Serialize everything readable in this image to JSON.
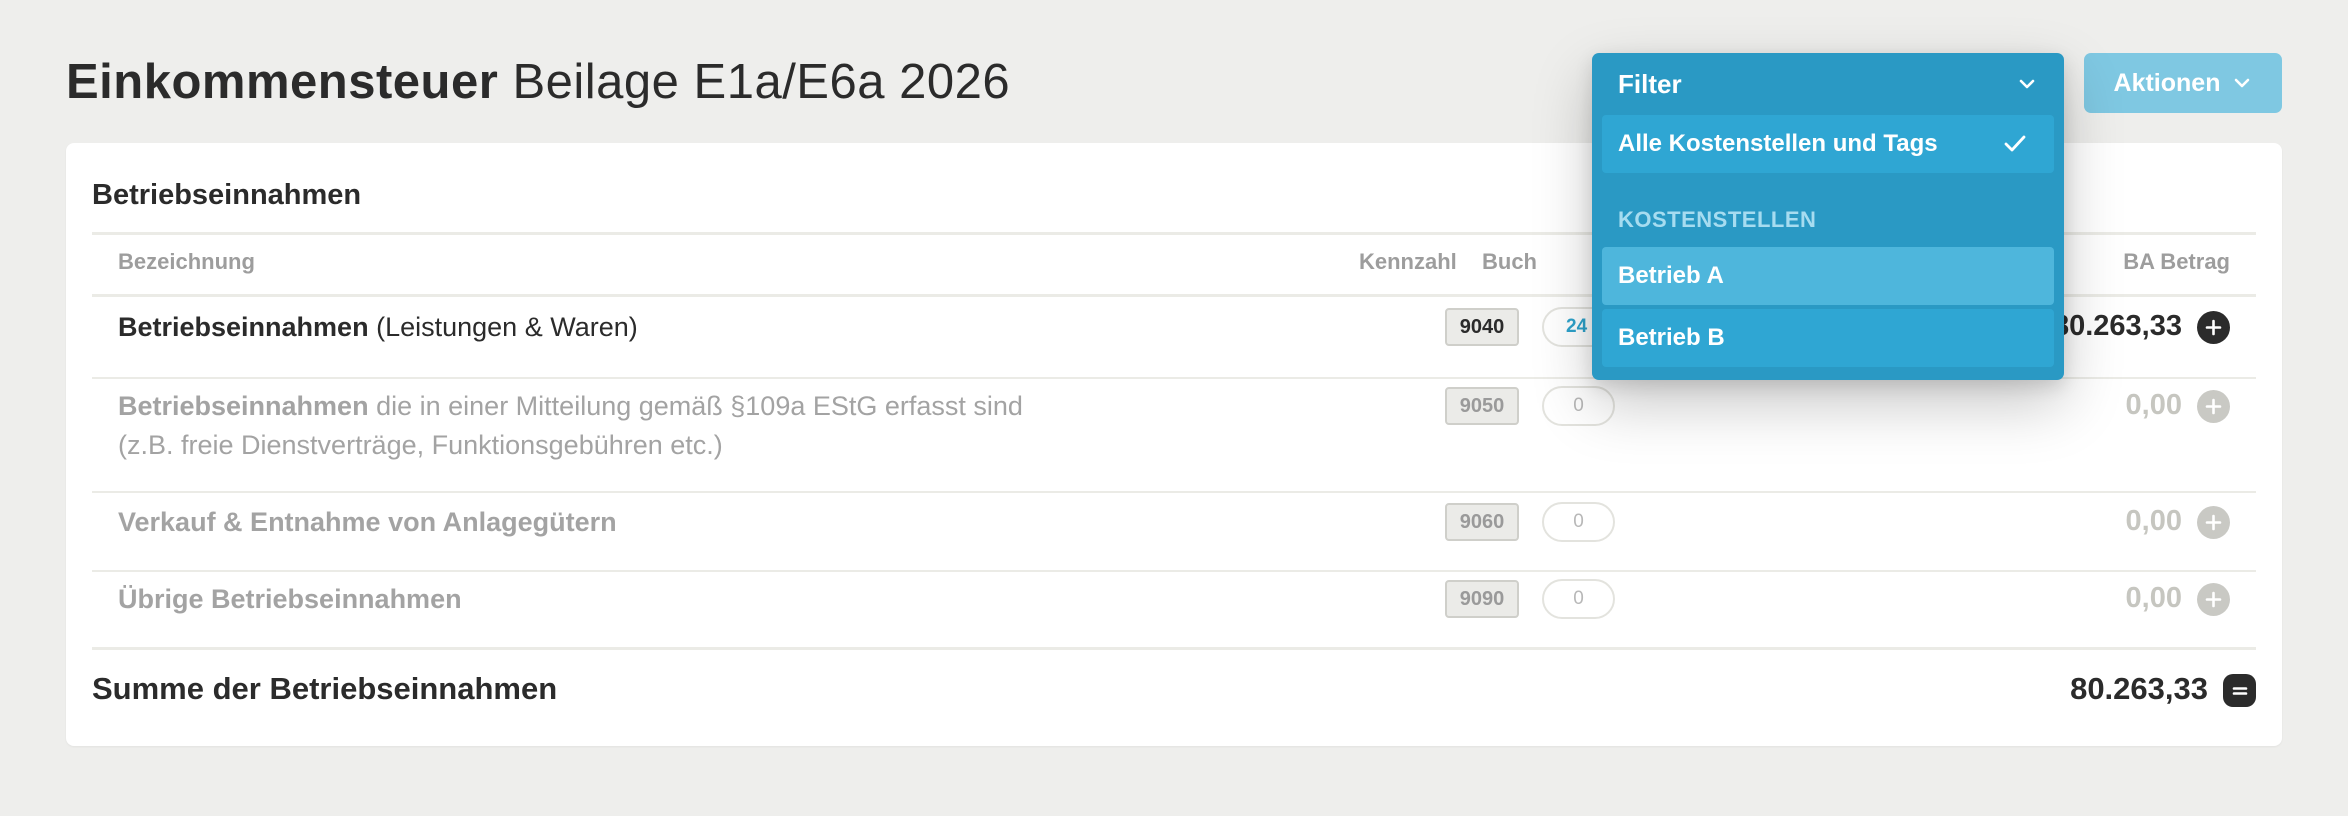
{
  "page": {
    "title_strong": "Einkommensteuer",
    "title_rest": "Beilage E1a/E6a 2026"
  },
  "actions": {
    "label": "Aktionen"
  },
  "filter": {
    "label": "Filter",
    "selected": "Alle Kostenstellen und Tags",
    "group_label": "KOSTENSTELLEN",
    "options": [
      "Betrieb A",
      "Betrieb B"
    ]
  },
  "section": {
    "title": "Betriebseinnahmen",
    "columns": {
      "bezeichnung": "Bezeichnung",
      "kennzahl": "Kennzahl",
      "buchungen": "Buch",
      "ba_betrag": "BA Betrag"
    },
    "rows": [
      {
        "label_bold": "Betriebseinnahmen",
        "label_rest": "(Leistungen & Waren)",
        "label_line2": "",
        "kennzahl": "9040",
        "count": "24",
        "amount": "80.263,33"
      },
      {
        "label_bold": "Betriebseinnahmen",
        "label_rest": "die in einer Mitteilung gemäß §109a EStG erfasst sind",
        "label_line2": "(z.B. freie Dienstverträge, Funktionsgebühren etc.)",
        "kennzahl": "9050",
        "count": "0",
        "amount": "0,00"
      },
      {
        "label_bold": "Verkauf & Entnahme von Anlagegütern",
        "label_rest": "",
        "label_line2": "",
        "kennzahl": "9060",
        "count": "0",
        "amount": "0,00"
      },
      {
        "label_bold": "Übrige Betriebseinnahmen",
        "label_rest": "",
        "label_line2": "",
        "kennzahl": "9090",
        "count": "0",
        "amount": "0,00"
      }
    ],
    "sum_label": "Summe der Betriebseinnahmen",
    "sum_amount": "80.263,33"
  }
}
